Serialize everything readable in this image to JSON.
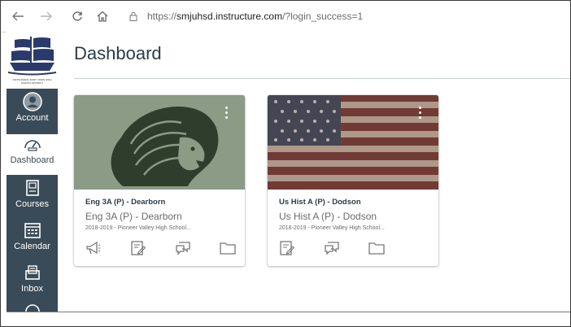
{
  "browser": {
    "url_prefix": "https://",
    "url_domain": "smjuhsd.instructure.com",
    "url_path": "/?login_success=1",
    "back_icon": "arrow-left-icon",
    "forward_icon": "arrow-right-icon",
    "reload_icon": "reload-icon",
    "home_icon": "home-icon"
  },
  "global_nav": {
    "logo_caption": "SANTA MARIA JOINT UNION HIGH SCHOOL DISTRICT",
    "items": [
      {
        "label": "Account",
        "icon": "account-icon",
        "active": false
      },
      {
        "label": "Dashboard",
        "icon": "dashboard-icon",
        "active": true
      },
      {
        "label": "Courses",
        "icon": "courses-icon",
        "active": false
      },
      {
        "label": "Calendar",
        "icon": "calendar-icon",
        "active": false
      },
      {
        "label": "Inbox",
        "icon": "inbox-icon",
        "active": false
      }
    ]
  },
  "main": {
    "title": "Dashboard",
    "cards": [
      {
        "title": "Eng 3A (P) - Dearborn",
        "subtitle": "Eng 3A (P) - Dearborn",
        "term": "2018-2019 - Pioneer Valley High School...",
        "color": "#8b9b86",
        "actions": [
          "announcements-icon",
          "assignments-icon",
          "discussions-icon",
          "files-icon"
        ]
      },
      {
        "title": "Us Hist A (P) - Dodson",
        "subtitle": "Us Hist A (P) - Dodson",
        "term": "2018-2019 - Pioneer Valley High School...",
        "color": "#7a3a36",
        "actions": [
          "assignments-icon",
          "discussions-icon",
          "files-icon"
        ]
      }
    ]
  },
  "colors": {
    "nav_bg": "#394b58",
    "text": "#2d3b45",
    "muted": "#6b6b6b"
  }
}
